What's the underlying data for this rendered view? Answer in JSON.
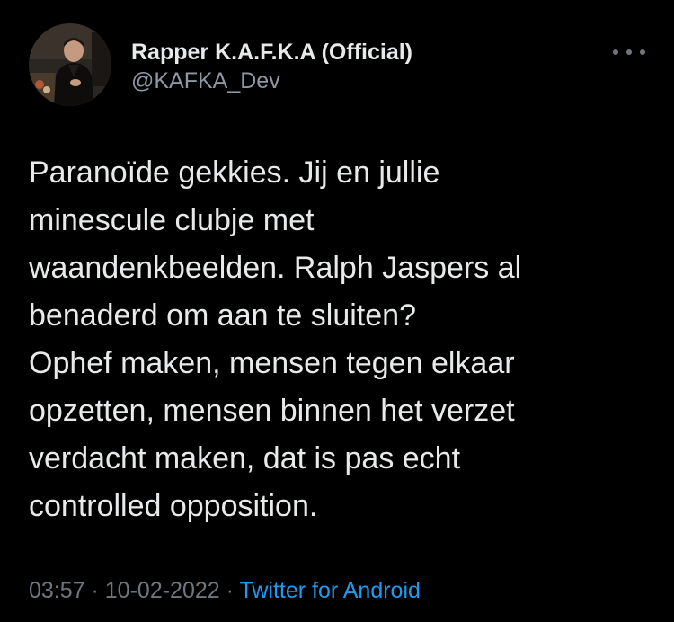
{
  "author": {
    "display_name": "Rapper K.A.F.K.A (Official)",
    "handle": "@KAFKA_Dev"
  },
  "menu": {
    "icon": "more-horizontal-icon"
  },
  "tweet": {
    "lines": [
      "Paranoïde gekkies. Jij en jullie",
      "minescule clubje met",
      "waandenkbeelden. Ralph Jaspers al",
      "benaderd om aan te sluiten?",
      "Ophef maken, mensen tegen elkaar",
      "opzetten, mensen binnen het verzet",
      "verdacht maken, dat is pas echt",
      "controlled opposition."
    ]
  },
  "meta": {
    "time": "03:57",
    "separator": " · ",
    "date": "10-02-2022",
    "source": "Twitter for Android"
  },
  "colors": {
    "background": "#000000",
    "text": "#e7e9ea",
    "secondary": "#8b98a5",
    "link": "#1d9bf0"
  }
}
